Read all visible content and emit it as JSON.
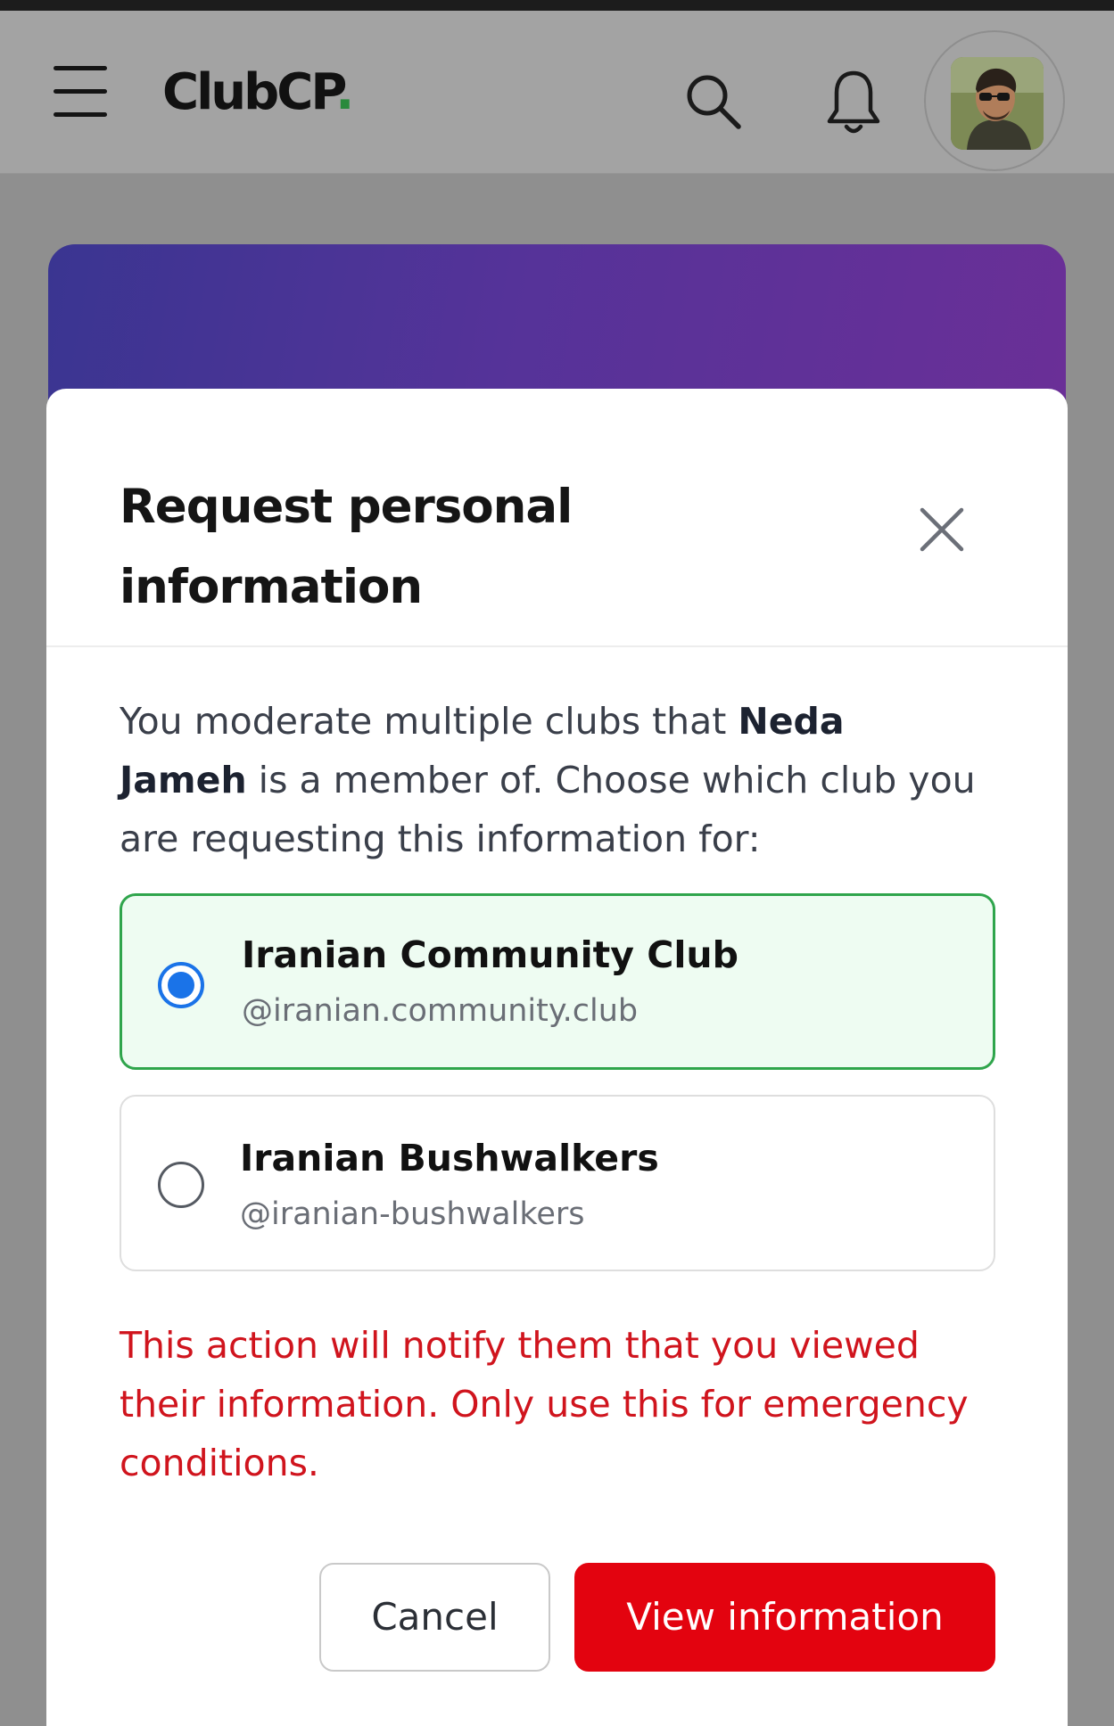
{
  "header": {
    "brand_name": "ClubCP",
    "brand_dot": ".",
    "brand_dot_color": "#2a8a3c",
    "menu_icon": "hamburger-menu-icon",
    "search_icon": "search-icon",
    "notification_icon": "bell-icon",
    "avatar": "user-avatar"
  },
  "banner": {
    "gradient_colors": [
      "#3a3591",
      "#6a2f97"
    ]
  },
  "modal": {
    "title": "Request personal information",
    "close_icon": "close-icon",
    "intro_before": "You moderate multiple clubs that ",
    "member_name": "Neda Jameh",
    "intro_after": " is a member of. Choose which club you are requesting this information for:",
    "clubs": [
      {
        "name": "Iranian Community Club",
        "handle": "@iranian.community.club",
        "selected": true
      },
      {
        "name": "Iranian Bushwalkers",
        "handle": "@iranian-bushwalkers",
        "selected": false
      }
    ],
    "warning": "This action will notify them that you viewed their information. Only use this for emergency conditions.",
    "warning_color": "#d0141d",
    "cancel_label": "Cancel",
    "confirm_label": "View information",
    "confirm_color": "#e3030f",
    "selected_accent": "#2fa54c",
    "radio_accent": "#1a73e8"
  }
}
